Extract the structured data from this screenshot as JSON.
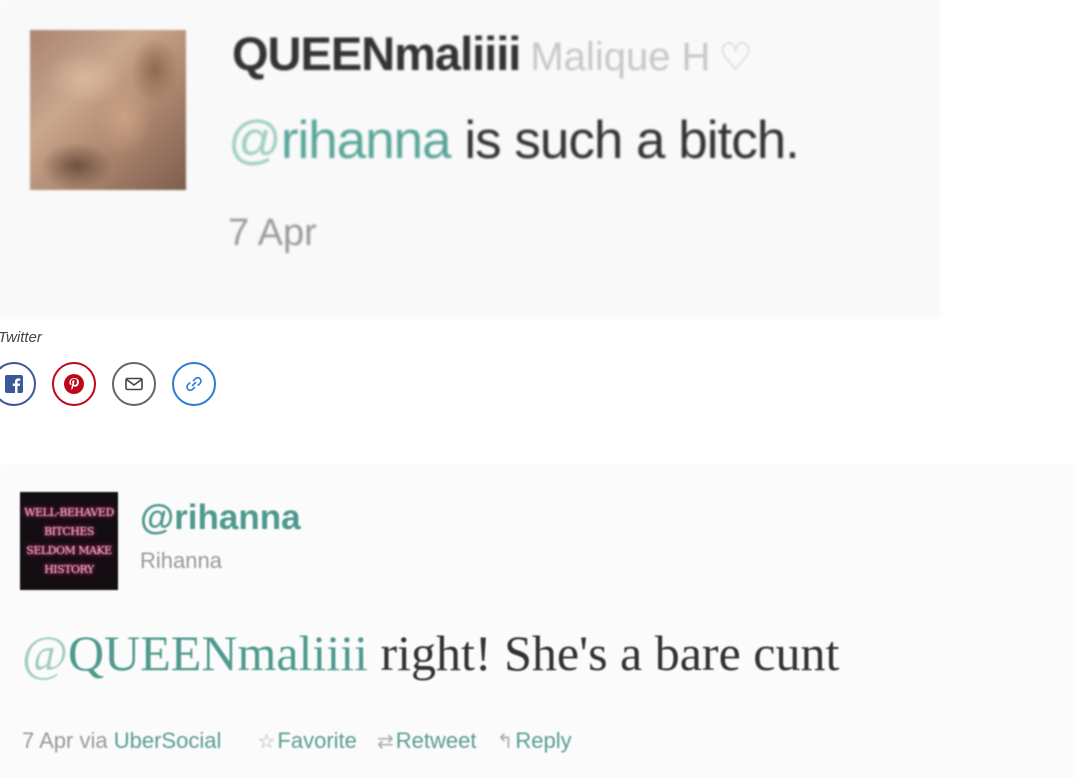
{
  "tweet1": {
    "username": "QUEENmaliiii",
    "display_name": "Malique H",
    "heart_icon": "heart-outline-icon",
    "text_at": "@",
    "text_mention": "rihanna",
    "text_rest": " is such a bitch.",
    "date": "7 Apr"
  },
  "credit": "Twitter",
  "share": {
    "icons": [
      "facebook-icon",
      "pinterest-icon",
      "email-icon",
      "link-icon"
    ],
    "colors": {
      "facebook": "#3b5998",
      "pinterest": "#bd081c",
      "email": "#666666",
      "link": "#2b7bd8"
    }
  },
  "tweet2": {
    "avatar_text": [
      "WELL-BEHAVED",
      "BITCHES",
      "SELDOM MAKE",
      "HISTORY"
    ],
    "username": "@rihanna",
    "display_name": "Rihanna",
    "text_at": "@",
    "text_mention": "QUEENmaliiii",
    "text_rest": " right! She's a bare cunt",
    "date": "7 Apr",
    "via": "via",
    "client": "UberSocial",
    "favorite": "Favorite",
    "retweet": "Retweet",
    "reply": "Reply"
  }
}
